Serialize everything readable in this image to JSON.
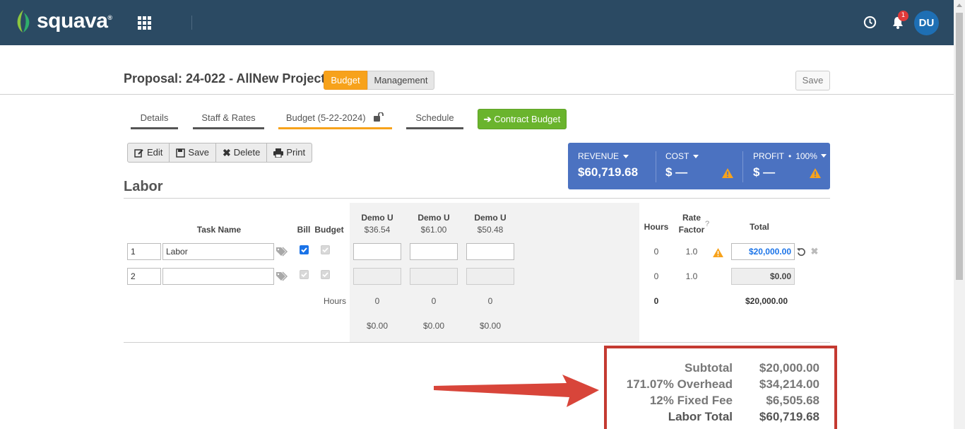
{
  "app": {
    "logo_text": "squava",
    "logo_reg": "®",
    "notification_count": "1",
    "user_initials": "DU"
  },
  "header": {
    "title": "Proposal: 24-022 - AllNew Project",
    "segments": [
      "Budget",
      "Management"
    ],
    "save_label": "Save"
  },
  "tabs": [
    "Details",
    "Staff & Rates",
    "Budget (5-22-2024)",
    "Schedule"
  ],
  "contract_button": "Contract Budget",
  "toolbar": {
    "edit": "Edit",
    "save": "Save",
    "delete": "Delete",
    "print": "Print"
  },
  "summary": {
    "revenue_label": "REVENUE",
    "revenue_value": "$60,719.68",
    "cost_label": "COST",
    "cost_value": "$ —",
    "profit_label": "PROFIT",
    "profit_pct": "100%",
    "profit_value": "$ —"
  },
  "labor": {
    "title": "Labor",
    "headers": {
      "task_name": "Task Name",
      "bill": "Bill",
      "budget": "Budget",
      "hours": "Hours",
      "rate_factor_1": "Rate",
      "rate_factor_2": "Factor",
      "rate_help": "?",
      "total": "Total"
    },
    "staff": [
      {
        "name": "Demo U",
        "rate": "$36.54"
      },
      {
        "name": "Demo U",
        "rate": "$61.00"
      },
      {
        "name": "Demo U",
        "rate": "$50.48"
      }
    ],
    "rows": [
      {
        "num": "1",
        "task": "Labor",
        "hours": "0",
        "rate_factor": "1.0",
        "total": "$20,000.00"
      },
      {
        "num": "2",
        "task": "",
        "hours": "0",
        "rate_factor": "1.0",
        "total": "$0.00"
      }
    ],
    "footer": {
      "hours_label": "Hours",
      "staff_hours": [
        "0",
        "0",
        "0"
      ],
      "staff_amounts": [
        "$0.00",
        "$0.00",
        "$0.00"
      ],
      "total_hours": "0",
      "total_amount": "$20,000.00"
    }
  },
  "totals": [
    {
      "label": "Subtotal",
      "value": "$20,000.00"
    },
    {
      "label": "171.07% Overhead",
      "value": "$34,214.00"
    },
    {
      "label": "12% Fixed Fee",
      "value": "$6,505.68"
    },
    {
      "label": "Labor Total",
      "value": "$60,719.68"
    }
  ],
  "colors": {
    "topbar": "#2b4a63",
    "accent_orange": "#f7a21b",
    "summary_blue": "#4b72c1",
    "green": "#6ab42d",
    "annotation_red": "#c43a31"
  }
}
